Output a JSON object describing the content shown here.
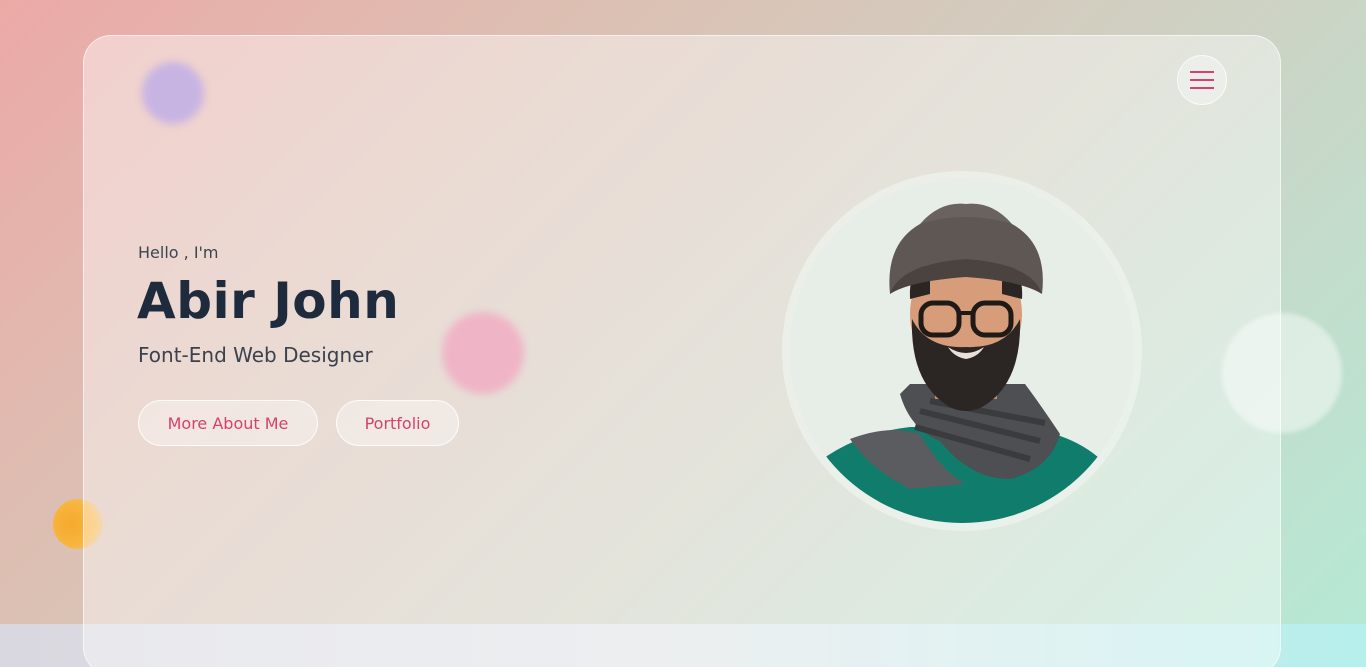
{
  "hero": {
    "greeting": "Hello , I'm",
    "name": "Abir John",
    "role": "Font-End Web Designer"
  },
  "buttons": {
    "more_about": "More About Me",
    "portfolio": "Portfolio"
  },
  "icons": {
    "menu": "hamburger-menu-icon",
    "profile": "profile-photo"
  },
  "colors": {
    "accent": "#d8406d",
    "heading": "#1e2b3d",
    "text": "#3a4250"
  }
}
